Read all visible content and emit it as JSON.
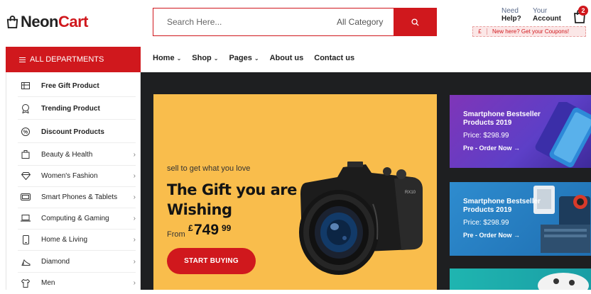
{
  "brand": {
    "part1": "Neon",
    "part2": "Cart"
  },
  "search": {
    "placeholder": "Search Here...",
    "category": "All Category"
  },
  "header": {
    "help_small": "Need",
    "help_big": "Help?",
    "account_small": "Your",
    "account_big": "Account",
    "cart_count": "2",
    "coupon_currency": "£",
    "coupon_text": "New here? Get your Coupons!"
  },
  "departments_label": "ALL DEPARTMENTS",
  "nav": [
    {
      "label": "Home",
      "dropdown": true
    },
    {
      "label": "Shop",
      "dropdown": true
    },
    {
      "label": "Pages",
      "dropdown": true
    },
    {
      "label": "About us",
      "dropdown": false
    },
    {
      "label": "Contact us",
      "dropdown": false
    }
  ],
  "sidebar": [
    {
      "label": "Free Gift Product",
      "icon": "gift-card-icon"
    },
    {
      "label": "Trending Product",
      "icon": "badge-icon"
    },
    {
      "label": "Discount Products",
      "icon": "percent-icon"
    },
    {
      "label": "Beauty & Health",
      "icon": "bottle-icon"
    },
    {
      "label": "Women's Fashion",
      "icon": "diamond-icon"
    },
    {
      "label": "Smart Phones & Tablets",
      "icon": "tablet-icon"
    },
    {
      "label": "Computing & Gaming",
      "icon": "laptop-icon"
    },
    {
      "label": "Home & Living",
      "icon": "phone-icon"
    },
    {
      "label": "Diamond",
      "icon": "heel-icon"
    },
    {
      "label": "Men",
      "icon": "shirt-icon"
    }
  ],
  "hero": {
    "subtitle": "sell to get what you love",
    "title_line1": "The Gift you are",
    "title_line2": "Wishing",
    "from": "From",
    "currency": "£",
    "price": "749",
    "cents": "99",
    "button": "START BUYING"
  },
  "banners": [
    {
      "title_line1": "Smartphone Bestseller",
      "title_line2": "Products 2019",
      "price": "Price: $298.99",
      "cta": "Pre - Order Now →"
    },
    {
      "title_line1": "Smartphone Bestseller",
      "title_line2": "Products 2019",
      "price": "Price: $298.99",
      "cta": "Pre - Order Now →"
    }
  ],
  "colors": {
    "accent": "#d0181d",
    "hero_bg": "#f9bd4c",
    "dark_bg": "#1e1f21"
  }
}
